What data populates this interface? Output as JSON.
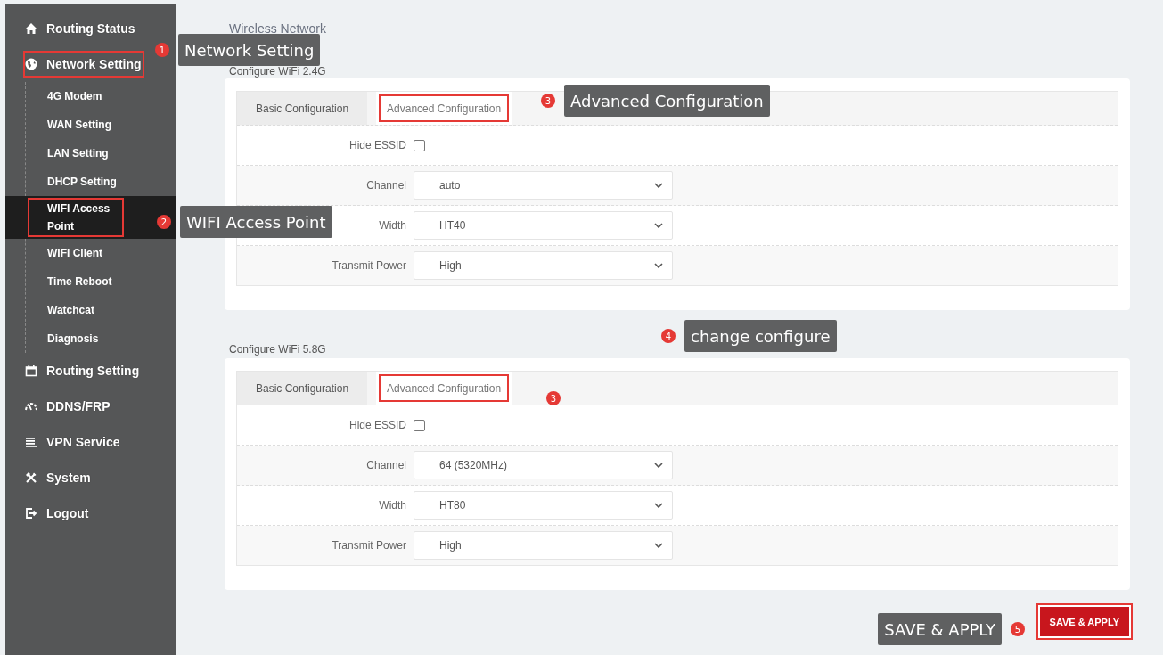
{
  "sidebar": {
    "items": [
      {
        "label": "Routing Status",
        "kind": "home",
        "highlighted": false
      },
      {
        "label": "Network Setting",
        "kind": "globe",
        "highlighted": true,
        "children": [
          {
            "label": "4G Modem",
            "selected": false,
            "highlighted": false
          },
          {
            "label": "WAN Setting",
            "selected": false,
            "highlighted": false
          },
          {
            "label": "LAN Setting",
            "selected": false,
            "highlighted": false
          },
          {
            "label": "DHCP Setting",
            "selected": false,
            "highlighted": false
          },
          {
            "label": "WIFI Access Point",
            "selected": true,
            "highlighted": true
          },
          {
            "label": "WIFI Client",
            "selected": false,
            "highlighted": false
          },
          {
            "label": "Time Reboot",
            "selected": false,
            "highlighted": false
          },
          {
            "label": "Watchcat",
            "selected": false,
            "highlighted": false
          },
          {
            "label": "Diagnosis",
            "selected": false,
            "highlighted": false
          }
        ]
      },
      {
        "label": "Routing Setting",
        "kind": "calendar",
        "highlighted": false
      },
      {
        "label": "DDNS/FRP",
        "kind": "gauge",
        "highlighted": false
      },
      {
        "label": "VPN Service",
        "kind": "list",
        "highlighted": false
      },
      {
        "label": "System",
        "kind": "tools",
        "highlighted": false
      },
      {
        "label": "Logout",
        "kind": "logout",
        "highlighted": false
      }
    ]
  },
  "main": {
    "title": "Wireless Network",
    "sections": [
      {
        "heading": "Configure WiFi 2.4G",
        "tabs": [
          {
            "label": "Basic Configuration",
            "selected": false,
            "highlighted": false
          },
          {
            "label": "Advanced Configuration",
            "selected": true,
            "highlighted": true
          }
        ],
        "rows": [
          {
            "kind": "checkbox",
            "label": "Hide ESSID",
            "checked": false
          },
          {
            "kind": "select",
            "label": "Channel",
            "value": "auto"
          },
          {
            "kind": "select",
            "label": "Width",
            "value": "HT40"
          },
          {
            "kind": "select",
            "label": "Transmit Power",
            "value": "High"
          }
        ]
      },
      {
        "heading": "Configure WiFi 5.8G",
        "tabs": [
          {
            "label": "Basic Configuration",
            "selected": false,
            "highlighted": false
          },
          {
            "label": "Advanced Configuration",
            "selected": true,
            "highlighted": true
          }
        ],
        "rows": [
          {
            "kind": "checkbox",
            "label": "Hide ESSID",
            "checked": false
          },
          {
            "kind": "select",
            "label": "Channel",
            "value": "64 (5320MHz)"
          },
          {
            "kind": "select",
            "label": "Width",
            "value": "HT80"
          },
          {
            "kind": "select",
            "label": "Transmit Power",
            "value": "High"
          }
        ]
      }
    ],
    "save_button": {
      "label": "SAVE & APPLY",
      "highlighted": true
    }
  },
  "annotations": [
    {
      "number": "1",
      "label": "Network Setting"
    },
    {
      "number": "2",
      "label": "WIFI Access Point"
    },
    {
      "number": "3",
      "label": "Advanced Configuration"
    },
    {
      "number": "3"
    },
    {
      "number": "4",
      "label": "change configure"
    },
    {
      "number": "5",
      "label": "SAVE & APPLY"
    }
  ]
}
